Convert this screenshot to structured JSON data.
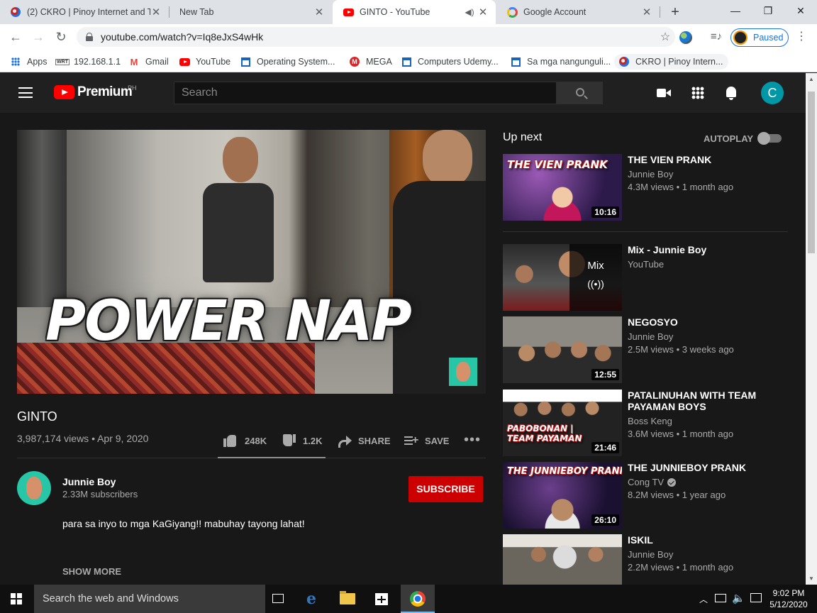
{
  "browser": {
    "tabs": [
      {
        "title": "(2) CKRO | Pinoy Internet and Te"
      },
      {
        "title": "New Tab"
      },
      {
        "title": "GINTO - YouTube"
      },
      {
        "title": "Google Account"
      }
    ],
    "url": "youtube.com/watch?v=Iq8eJxS4wHk",
    "paused_label": "Paused",
    "bookmarks": [
      {
        "label": "Apps"
      },
      {
        "label": "192.168.1.1",
        "icon_text": "WRT"
      },
      {
        "label": "Gmail",
        "icon_text": "M"
      },
      {
        "label": "YouTube"
      },
      {
        "label": "Operating System..."
      },
      {
        "label": "MEGA",
        "icon_text": "M"
      },
      {
        "label": "Computers Udemy..."
      },
      {
        "label": "Sa mga nangunguli..."
      },
      {
        "label": "CKRO | Pinoy Intern..."
      }
    ]
  },
  "youtube": {
    "logo_text": "Premium",
    "region": "PH",
    "search_placeholder": "Search",
    "account_initial": "C",
    "video": {
      "overlay_title": "POWER NAP",
      "title": "GINTO",
      "meta": "3,987,174 views • Apr 9, 2020",
      "likes": "248K",
      "dislikes": "1.2K",
      "share": "SHARE",
      "save": "SAVE"
    },
    "owner": {
      "name": "Junnie Boy",
      "subscribers": "2.33M subscribers",
      "subscribe": "SUBSCRIBE"
    },
    "description": "para sa inyo to mga KaGiyang!! mabuhay tayong lahat!",
    "show_more": "SHOW MORE",
    "up_next": "Up next",
    "autoplay": "AUTOPLAY",
    "recommendations": [
      {
        "title": "THE VIEN PRANK",
        "channel": "Junnie Boy",
        "meta": "4.3M views • 1 month ago",
        "duration": "10:16",
        "thumb_text": "THE VIEN PRANK",
        "color": "#6a2c8a"
      },
      {
        "title": "Mix - Junnie Boy",
        "channel": "YouTube",
        "meta": "",
        "mix_label": "Mix",
        "color": "#3b3b3b"
      },
      {
        "title": "NEGOSYO",
        "channel": "Junnie Boy",
        "meta": "2.5M views • 3 weeks ago",
        "duration": "12:55",
        "color": "#6e6a62"
      },
      {
        "title": "PATALINUHAN WITH TEAM PAYAMAN BOYS",
        "channel": "Boss Keng",
        "meta": "3.6M views • 1 month ago",
        "duration": "21:46",
        "thumb_text": "PABOBONAN | TEAM PAYAMAN",
        "color": "#2a2a2a"
      },
      {
        "title": "THE JUNNIEBOY PRANK",
        "channel": "Cong TV",
        "meta": "8.2M views • 1 year ago",
        "duration": "26:10",
        "thumb_text": "THE JUNNIEBOY PRANK",
        "color": "#3a2a5a",
        "verified": true
      },
      {
        "title": "ISKIL",
        "channel": "Junnie Boy",
        "meta": "2.2M views • 1 month ago",
        "color": "#5a5650"
      }
    ]
  },
  "taskbar": {
    "search_placeholder": "Search the web and Windows",
    "time": "9:02 PM",
    "date": "5/12/2020"
  }
}
